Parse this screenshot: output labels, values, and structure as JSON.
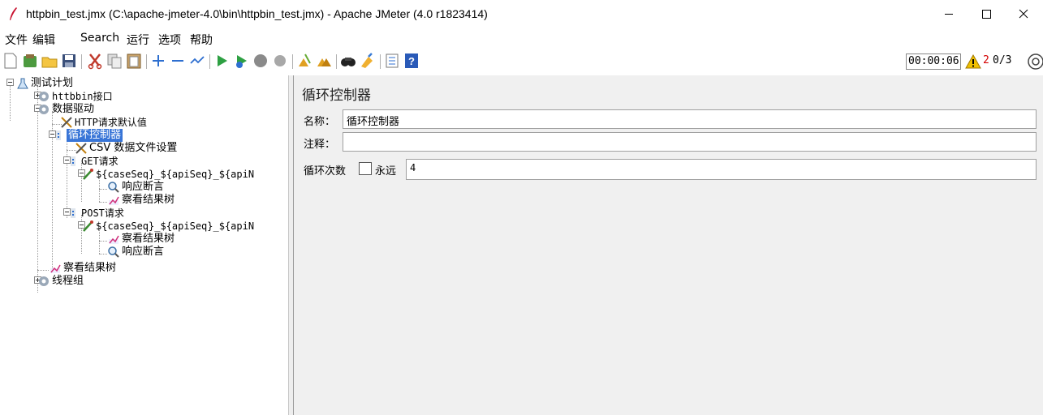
{
  "window": {
    "title": "httpbin_test.jmx (C:\\apache-jmeter-4.0\\bin\\httpbin_test.jmx) - Apache JMeter (4.0 r1823414)",
    "controls": [
      "minimize-icon",
      "maximize-icon",
      "close-icon"
    ]
  },
  "menu": {
    "file": "文件",
    "edit": "编辑",
    "search": "Search",
    "run": "运行",
    "options": "选项",
    "help": "帮助"
  },
  "toolbar": {
    "icons": [
      "new-icon",
      "templates-icon",
      "open-icon",
      "save-icon",
      "cut-icon",
      "copy-icon",
      "paste-icon",
      "expand-icon",
      "collapse-icon",
      "toggle-icon",
      "start-icon",
      "start-no-pause-icon",
      "stop-icon",
      "shutdown-icon",
      "clear-icon",
      "clear-all-icon",
      "search-icon",
      "reset-search-icon",
      "function-helper-icon",
      "help-icon"
    ],
    "elapsed_time": "00:00:06",
    "error_count": "2",
    "thread_count": "0/3",
    "warning_color": "#f0c000",
    "error_color": "#d40000"
  },
  "tree": {
    "nodes": [
      {
        "label": "测试计划",
        "icon": "test-plan-icon"
      },
      {
        "label": "httbbin接口",
        "icon": "thread-group-icon"
      },
      {
        "label": "数据驱动",
        "icon": "thread-group-icon"
      },
      {
        "label": "HTTP请求默认值",
        "icon": "config-element-icon"
      },
      {
        "label": "循环控制器",
        "icon": "loop-controller-icon",
        "selected": true
      },
      {
        "label": "CSV 数据文件设置",
        "icon": "config-element-icon"
      },
      {
        "label": "GET请求",
        "icon": "controller-icon"
      },
      {
        "label": "${caseSeq}_${apiSeq}_${apiN",
        "icon": "sampler-icon"
      },
      {
        "label": "响应断言",
        "icon": "assertion-icon"
      },
      {
        "label": "察看结果树",
        "icon": "listener-icon"
      },
      {
        "label": "POST请求",
        "icon": "controller-icon"
      },
      {
        "label": "${caseSeq}_${apiSeq}_${apiN",
        "icon": "sampler-icon"
      },
      {
        "label": "察看结果树",
        "icon": "listener-icon"
      },
      {
        "label": "响应断言",
        "icon": "assertion-icon"
      },
      {
        "label": "察看结果树",
        "icon": "listener-icon"
      },
      {
        "label": "线程组",
        "icon": "thread-group-icon"
      }
    ],
    "selection_color": "#3875d7"
  },
  "editor": {
    "title": "循环控制器",
    "name_label": "名称：",
    "name_value": "循环控制器",
    "comment_label": "注释：",
    "comment_value": "",
    "loop_count_label": "循环次数",
    "forever_label": "永远",
    "forever_checked": false,
    "loop_count_value": "4"
  }
}
